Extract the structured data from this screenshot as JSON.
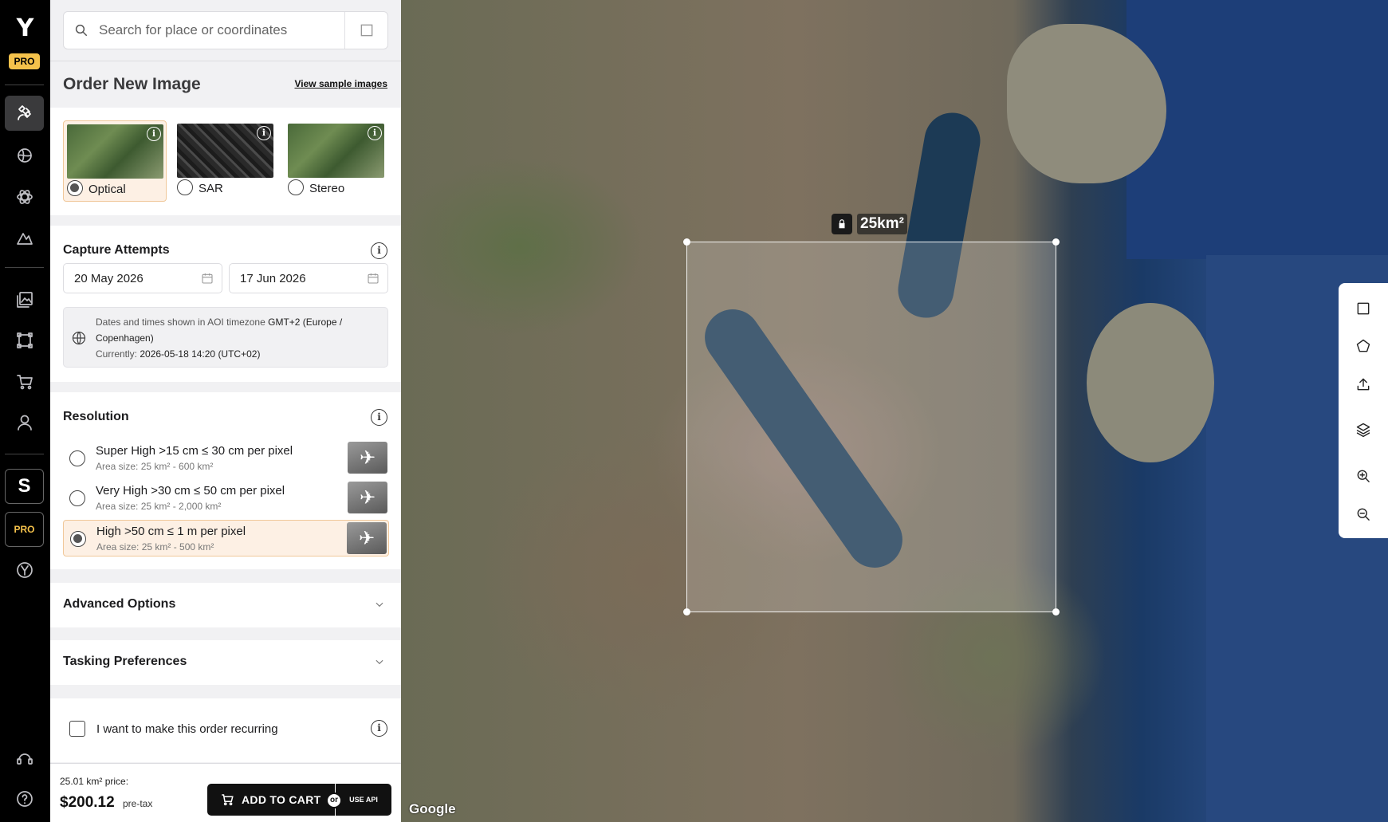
{
  "rail": {
    "logo": "Y",
    "pro_badge": "PRO",
    "s_button": "S",
    "pro_button": "PRO",
    "items": [
      {
        "icon": "satellite-icon"
      },
      {
        "icon": "globe-pin-icon"
      },
      {
        "icon": "atom-icon"
      },
      {
        "icon": "terrain-icon"
      },
      {
        "icon": "gallery-icon"
      },
      {
        "icon": "aoi-frame-icon"
      },
      {
        "icon": "cart-icon"
      },
      {
        "icon": "user-icon"
      },
      {
        "icon": "brand-circle-icon"
      },
      {
        "icon": "support-icon"
      },
      {
        "icon": "help-icon"
      }
    ]
  },
  "search": {
    "placeholder": "Search for place or coordinates"
  },
  "order": {
    "title": "Order New Image",
    "sample_link": "View sample images",
    "image_types": [
      {
        "label": "Optical",
        "selected": true
      },
      {
        "label": "SAR",
        "selected": false
      },
      {
        "label": "Stereo",
        "selected": false
      }
    ]
  },
  "capture": {
    "title": "Capture Attempts",
    "start_date": "20 May 2026",
    "end_date": "17 Jun 2026",
    "tz_prefix": "Dates and times shown in AOI timezone",
    "tz_value": "GMT+2 (Europe / Copenhagen)",
    "current_prefix": "Currently:",
    "current_value": "2026-05-18 14:20 (UTC+02)"
  },
  "resolution": {
    "title": "Resolution",
    "options": [
      {
        "name": "Super High >15 cm ≤ 30 cm per pixel",
        "area": "Area size: 25 km² - 600 km²",
        "selected": false
      },
      {
        "name": "Very High >30 cm ≤ 50 cm per pixel",
        "area": "Area size: 25 km² - 2,000 km²",
        "selected": false
      },
      {
        "name": "High >50 cm ≤ 1 m per pixel",
        "area": "Area size: 25 km² - 500 km²",
        "selected": true
      }
    ]
  },
  "advanced": {
    "title": "Advanced Options"
  },
  "tasking": {
    "title": "Tasking Preferences"
  },
  "recurring": {
    "label": "I want to make this order recurring",
    "checked": false
  },
  "footer": {
    "price_label": "25.01 km² price:",
    "price": "$200.12",
    "tax_note": "pre-tax",
    "add_to_cart": "ADD TO CART",
    "or": "or",
    "use_api": "USE API"
  },
  "map": {
    "area_label": "25km²",
    "attribution": "Google",
    "tools": [
      "rectangle-icon",
      "polygon-icon",
      "upload-icon",
      "layers-icon",
      "zoom-in-icon",
      "zoom-out-icon"
    ]
  }
}
